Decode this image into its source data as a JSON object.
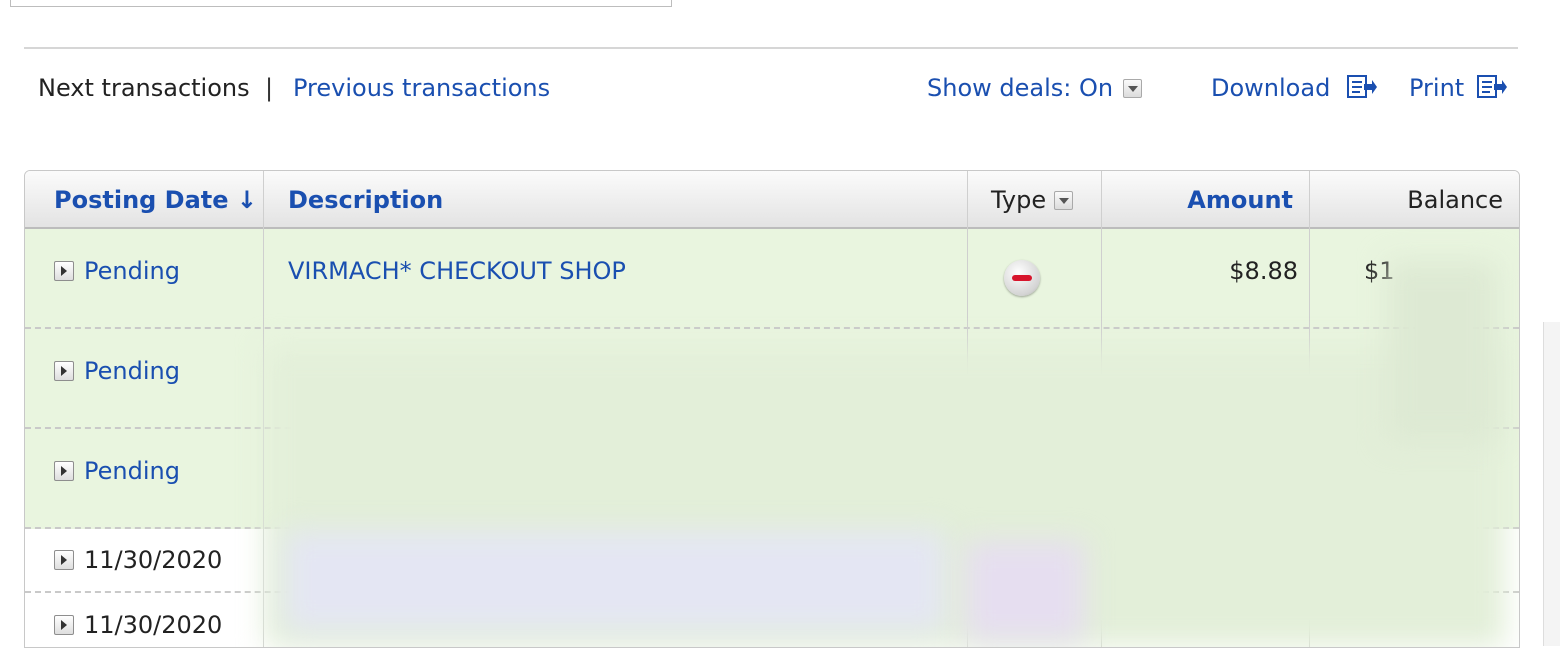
{
  "nav": {
    "next_label": "Next transactions",
    "separator": "|",
    "previous_label": "Previous transactions",
    "show_deals_label": "Show deals: On",
    "download_label": "Download",
    "print_label": "Print"
  },
  "table": {
    "headers": {
      "posting_date": "Posting Date ↓",
      "description": "Description",
      "type": "Type",
      "amount": "Amount",
      "balance": "Balance"
    },
    "rows": [
      {
        "date": "Pending",
        "description": "VIRMACH* CHECKOUT SHOP",
        "type_icon": "debit-icon",
        "amount": "$8.88",
        "balance": "$1"
      },
      {
        "date": "Pending"
      },
      {
        "date": "Pending"
      },
      {
        "date": "11/30/2020"
      },
      {
        "date": "11/30/2020"
      }
    ]
  },
  "colors": {
    "link": "#1a4fb0",
    "pending_row": "#e9f5df",
    "debit_mark": "#d7152c"
  }
}
